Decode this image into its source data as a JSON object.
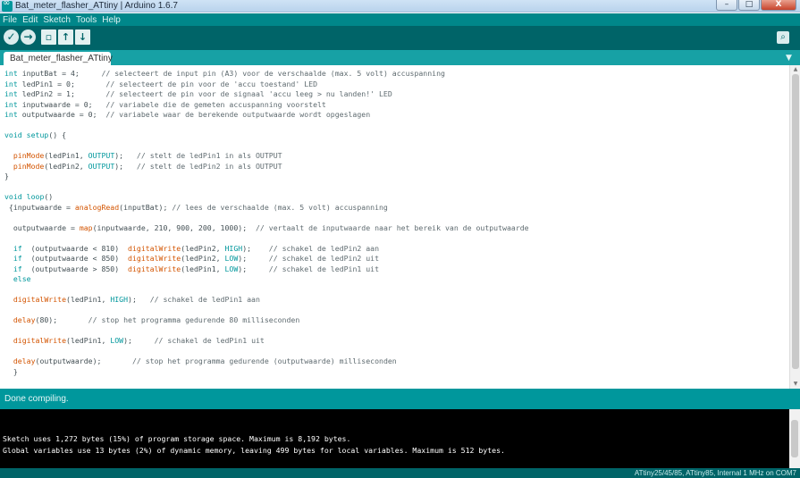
{
  "window": {
    "title": "Bat_meter_flasher_ATtiny | Arduino 1.6.7",
    "minimize": "–",
    "maximize": "□",
    "close": "X"
  },
  "menu": [
    "File",
    "Edit",
    "Sketch",
    "Tools",
    "Help"
  ],
  "toolbar": {
    "verify": "✓",
    "upload": "→",
    "new": "▫",
    "open": "↑",
    "save": "↓",
    "serial": "⌕"
  },
  "tab": {
    "label": "Bat_meter_flasher_ATtiny",
    "menu": "▼"
  },
  "code_lines": [
    [
      {
        "t": "int",
        "c": "kw"
      },
      {
        "t": " inputBat = 4;     "
      },
      {
        "t": "// selecteert de input pin (A3) voor de verschaalde (max. 5 volt) accuspanning",
        "c": "cm"
      }
    ],
    [
      {
        "t": "int",
        "c": "kw"
      },
      {
        "t": " ledPin1 = 0;       "
      },
      {
        "t": "// selecteert de pin voor de 'accu toestand' LED",
        "c": "cm"
      }
    ],
    [
      {
        "t": "int",
        "c": "kw"
      },
      {
        "t": " ledPin2 = 1;       "
      },
      {
        "t": "// selecteert de pin voor de signaal 'accu leeg > nu landen!' LED",
        "c": "cm"
      }
    ],
    [
      {
        "t": "int",
        "c": "kw"
      },
      {
        "t": " inputwaarde = 0;   "
      },
      {
        "t": "// variabele die de gemeten accuspanning voorstelt",
        "c": "cm"
      }
    ],
    [
      {
        "t": "int",
        "c": "kw"
      },
      {
        "t": " outputwaarde = 0;  "
      },
      {
        "t": "// variabele waar de berekende outputwaarde wordt opgeslagen",
        "c": "cm"
      }
    ],
    [],
    [
      {
        "t": "void",
        "c": "kw"
      },
      {
        "t": " "
      },
      {
        "t": "setup",
        "c": "kw"
      },
      {
        "t": "() {"
      }
    ],
    [],
    [
      {
        "t": "  "
      },
      {
        "t": "pinMode",
        "c": "fn"
      },
      {
        "t": "(ledPin1, "
      },
      {
        "t": "OUTPUT",
        "c": "cn"
      },
      {
        "t": ");   "
      },
      {
        "t": "// stelt de ledPin1 in als OUTPUT",
        "c": "cm"
      }
    ],
    [
      {
        "t": "  "
      },
      {
        "t": "pinMode",
        "c": "fn"
      },
      {
        "t": "(ledPin2, "
      },
      {
        "t": "OUTPUT",
        "c": "cn"
      },
      {
        "t": ");   "
      },
      {
        "t": "// stelt de ledPin2 in als OUTPUT",
        "c": "cm"
      }
    ],
    [
      {
        "t": "}"
      }
    ],
    [],
    [
      {
        "t": "void",
        "c": "kw"
      },
      {
        "t": " "
      },
      {
        "t": "loop",
        "c": "kw"
      },
      {
        "t": "()"
      }
    ],
    [
      {
        "t": " {inputwaarde = "
      },
      {
        "t": "analogRead",
        "c": "fn"
      },
      {
        "t": "(inputBat); "
      },
      {
        "t": "// lees de verschaalde (max. 5 volt) accuspanning",
        "c": "cm"
      }
    ],
    [],
    [
      {
        "t": "  outputwaarde = "
      },
      {
        "t": "map",
        "c": "fn"
      },
      {
        "t": "(inputwaarde, 210, 900, 200, 1000);  "
      },
      {
        "t": "// vertaalt de inputwaarde naar het bereik van de outputwaarde",
        "c": "cm"
      }
    ],
    [],
    [
      {
        "t": "  "
      },
      {
        "t": "if",
        "c": "kw"
      },
      {
        "t": "  (outputwaarde < 810)  "
      },
      {
        "t": "digitalWrite",
        "c": "fn"
      },
      {
        "t": "(ledPin2, "
      },
      {
        "t": "HIGH",
        "c": "cn"
      },
      {
        "t": ");    "
      },
      {
        "t": "// schakel de ledPin2 aan",
        "c": "cm"
      }
    ],
    [
      {
        "t": "  "
      },
      {
        "t": "if",
        "c": "kw"
      },
      {
        "t": "  (outputwaarde < 850)  "
      },
      {
        "t": "digitalWrite",
        "c": "fn"
      },
      {
        "t": "(ledPin2, "
      },
      {
        "t": "LOW",
        "c": "cn"
      },
      {
        "t": ");     "
      },
      {
        "t": "// schakel de ledPin2 uit",
        "c": "cm"
      }
    ],
    [
      {
        "t": "  "
      },
      {
        "t": "if",
        "c": "kw"
      },
      {
        "t": "  (outputwaarde > 850)  "
      },
      {
        "t": "digitalWrite",
        "c": "fn"
      },
      {
        "t": "(ledPin1, "
      },
      {
        "t": "LOW",
        "c": "cn"
      },
      {
        "t": ");     "
      },
      {
        "t": "// schakel de ledPin1 uit",
        "c": "cm"
      }
    ],
    [
      {
        "t": "  "
      },
      {
        "t": "else",
        "c": "kw"
      }
    ],
    [],
    [
      {
        "t": "  "
      },
      {
        "t": "digitalWrite",
        "c": "fn"
      },
      {
        "t": "(ledPin1, "
      },
      {
        "t": "HIGH",
        "c": "cn"
      },
      {
        "t": ");   "
      },
      {
        "t": "// schakel de ledPin1 aan",
        "c": "cm"
      }
    ],
    [],
    [
      {
        "t": "  "
      },
      {
        "t": "delay",
        "c": "fn"
      },
      {
        "t": "(80);       "
      },
      {
        "t": "// stop het programma gedurende 80 milliseconden",
        "c": "cm"
      }
    ],
    [],
    [
      {
        "t": "  "
      },
      {
        "t": "digitalWrite",
        "c": "fn"
      },
      {
        "t": "(ledPin1, "
      },
      {
        "t": "LOW",
        "c": "cn"
      },
      {
        "t": ");     "
      },
      {
        "t": "// schakel de ledPin1 uit",
        "c": "cm"
      }
    ],
    [],
    [
      {
        "t": "  "
      },
      {
        "t": "delay",
        "c": "fn"
      },
      {
        "t": "(outputwaarde);       "
      },
      {
        "t": "// stop het programma gedurende (outputwaarde) milliseconden",
        "c": "cm"
      }
    ],
    [
      {
        "t": "  }"
      }
    ]
  ],
  "status": {
    "message": "Done compiling."
  },
  "console": [
    "Sketch uses 1,272 bytes (15%) of program storage space. Maximum is 8,192 bytes.",
    "Global variables use 13 bytes (2%) of dynamic memory, leaving 499 bytes for local variables. Maximum is 512 bytes."
  ],
  "boardbar": {
    "text": "ATtiny25/45/85, ATtiny85, Internal 1 MHz on COM7"
  },
  "colors": {
    "toolbar": "#006468",
    "menubar": "#00878a",
    "tabbar": "#17a1a5",
    "status": "#00979c",
    "console": "#000000"
  }
}
